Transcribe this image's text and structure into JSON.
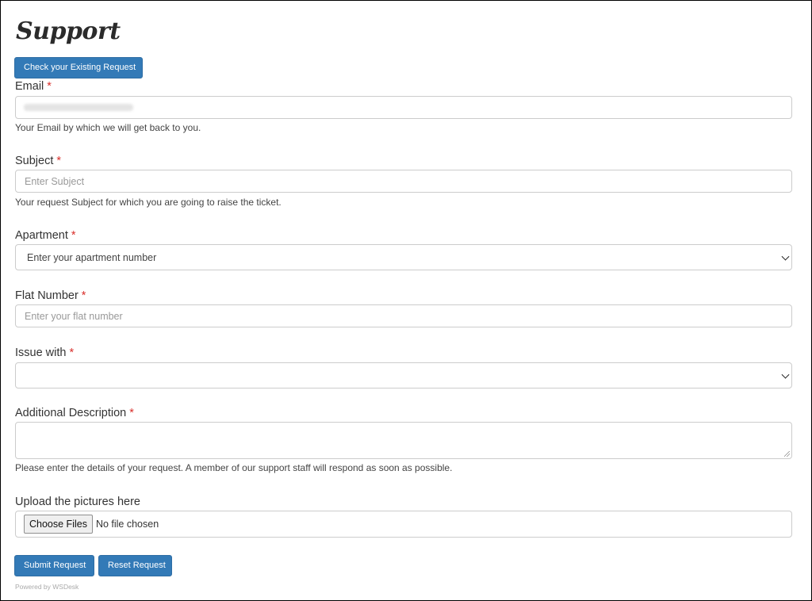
{
  "page": {
    "title": "Support",
    "check_existing_button": "Check your Existing Request"
  },
  "form": {
    "email": {
      "label": "Email",
      "required_mark": "*",
      "help": "Your Email by which we will get back to you."
    },
    "subject": {
      "label": "Subject",
      "required_mark": "*",
      "placeholder": "Enter Subject",
      "help": "Your request Subject for which you are going to raise the ticket."
    },
    "apartment": {
      "label": "Apartment",
      "required_mark": "*",
      "selected": "Enter your apartment number"
    },
    "flat_number": {
      "label": "Flat Number",
      "required_mark": "*",
      "placeholder": "Enter your flat number"
    },
    "issue_with": {
      "label": "Issue with",
      "required_mark": "*",
      "selected": ""
    },
    "description": {
      "label": "Additional Description",
      "required_mark": "*",
      "help": "Please enter the details of your request. A member of our support staff will respond as soon as possible."
    },
    "upload": {
      "label": "Upload the pictures here",
      "choose_button": "Choose Files",
      "status": "No file chosen"
    }
  },
  "actions": {
    "submit": "Submit Request",
    "reset": "Reset Request"
  },
  "footer": {
    "powered_by": "Powered by WSDesk"
  },
  "colors": {
    "primary_button": "#337ab7",
    "required": "#d9302c"
  }
}
